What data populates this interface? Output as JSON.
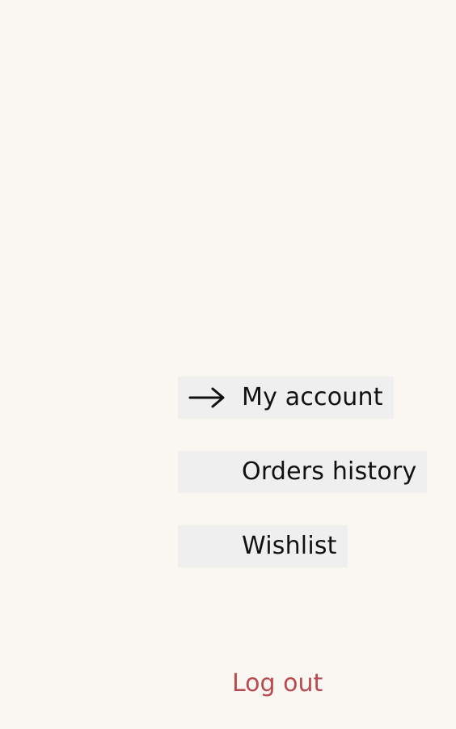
{
  "menu": {
    "items": [
      {
        "label": "My account",
        "active": true,
        "indicator_icon": "arrow-right-icon"
      },
      {
        "label": "Orders history",
        "active": false
      },
      {
        "label": "Wishlist",
        "active": false
      }
    ]
  },
  "logout": {
    "label": "Log out",
    "color": "#b84b50"
  },
  "colors": {
    "background": "#faf6f1",
    "item_background": "#efefef",
    "text": "#111111"
  }
}
